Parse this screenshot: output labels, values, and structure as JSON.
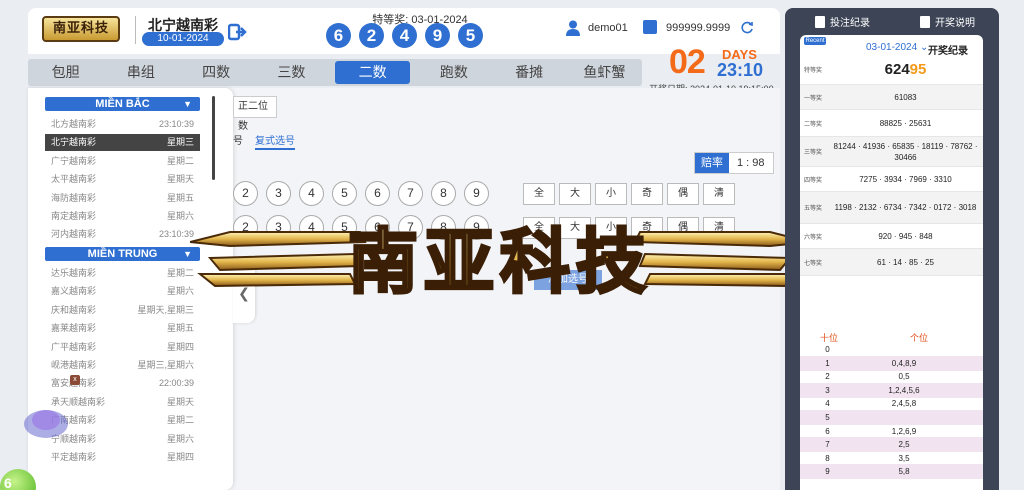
{
  "header": {
    "logo_text": "南亚科技",
    "lottery_name": "北宁越南彩",
    "lottery_date": "10-01-2024",
    "special_label": "特等奖: 03-01-2024",
    "special_balls": [
      "6",
      "2",
      "4",
      "9",
      "5"
    ],
    "username": "demo01",
    "balance": "999999.9999"
  },
  "countdown": {
    "number": "02",
    "unit": "DAYS",
    "time": "23:10",
    "draw_date": "开奖日期: 2024-01-10 19:15:00"
  },
  "tabs": [
    {
      "label": "包胆",
      "active": false
    },
    {
      "label": "串组",
      "active": false
    },
    {
      "label": "四数",
      "active": false
    },
    {
      "label": "三数",
      "active": false
    },
    {
      "label": "二数",
      "active": true
    },
    {
      "label": "跑数",
      "active": false
    },
    {
      "label": "番摊",
      "active": false
    },
    {
      "label": "鱼虾蟹",
      "active": false
    }
  ],
  "sidebar": {
    "north_region": "MIỀN BẮC",
    "central_region": "MIỀN TRUNG",
    "north": [
      {
        "name": "北方越南彩",
        "time": "23:10:39"
      },
      {
        "name": "北宁越南彩",
        "time": "星期三",
        "selected": true
      },
      {
        "name": "广宁越南彩",
        "time": "星期二"
      },
      {
        "name": "太平越南彩",
        "time": "星期天"
      },
      {
        "name": "海防越南彩",
        "time": "星期五"
      },
      {
        "name": "南定越南彩",
        "time": "星期六"
      },
      {
        "name": "河内越南彩",
        "time": "23:10:39"
      }
    ],
    "central": [
      {
        "name": "达乐越南彩",
        "time": "星期二"
      },
      {
        "name": "嘉义越南彩",
        "time": "星期六"
      },
      {
        "name": "庆和越南彩",
        "time": "星期天,星期三"
      },
      {
        "name": "嘉莱越南彩",
        "time": "星期五"
      },
      {
        "name": "广平越南彩",
        "time": "星期四"
      },
      {
        "name": "岘港越南彩",
        "time": "星期三,星期六"
      },
      {
        "name": "富安越南彩",
        "time": "22:00:39"
      },
      {
        "name": "承天顺越南彩",
        "time": "星期天"
      },
      {
        "name": "广南越南彩",
        "time": "星期二"
      },
      {
        "name": "宁顺越南彩",
        "time": "星期六"
      },
      {
        "name": "平定越南彩",
        "time": "星期四"
      }
    ]
  },
  "content": {
    "sub_tab": "正二位数",
    "mode_direct": "号",
    "mode_compound": "复式选号",
    "rate_label": "赔率",
    "rate_value": "1 : 98",
    "numbers": [
      "2",
      "3",
      "4",
      "5",
      "6",
      "7",
      "8",
      "9"
    ],
    "quick_buttons": [
      "全",
      "大",
      "小",
      "奇",
      "偶",
      "清"
    ],
    "add_button": "添加选号"
  },
  "watermark_text": "南亚科技",
  "right_panel": {
    "bet_records": "投注纪录",
    "rules": "开奖说明",
    "badge": "Recent",
    "date": "03-01-2024",
    "date_caret": "⌄",
    "title": "开奖纪录",
    "prizes": [
      {
        "name": "特等奖",
        "value_main": "624",
        "value_hl": "95",
        "big": true
      },
      {
        "name": "一等奖",
        "value": "61083"
      },
      {
        "name": "二等奖",
        "value": "88825 · 25631"
      },
      {
        "name": "三等奖",
        "value": "81244 · 41936 · 65835 · 18119 · 78762 · 30466"
      },
      {
        "name": "四等奖",
        "value": "7275 · 3934 · 7969 · 3310"
      },
      {
        "name": "五等奖",
        "value": "1198 · 2132 · 6734 · 7342 · 0172 · 3018"
      },
      {
        "name": "六等奖",
        "value": "920 · 945 · 848"
      },
      {
        "name": "七等奖",
        "value": "61 · 14 · 85 · 25"
      }
    ],
    "tens_header": "十位",
    "ones_header": "个位",
    "digits": [
      {
        "t": "0",
        "o": ""
      },
      {
        "t": "1",
        "o": "0,4,8,9"
      },
      {
        "t": "2",
        "o": "0,5"
      },
      {
        "t": "3",
        "o": "1,2,4,5,6"
      },
      {
        "t": "4",
        "o": "2,4,5,8"
      },
      {
        "t": "5",
        "o": ""
      },
      {
        "t": "6",
        "o": "1,2,6,9"
      },
      {
        "t": "7",
        "o": "2,5"
      },
      {
        "t": "8",
        "o": "3,5"
      },
      {
        "t": "9",
        "o": "5,8"
      }
    ]
  },
  "float_ball": "6"
}
